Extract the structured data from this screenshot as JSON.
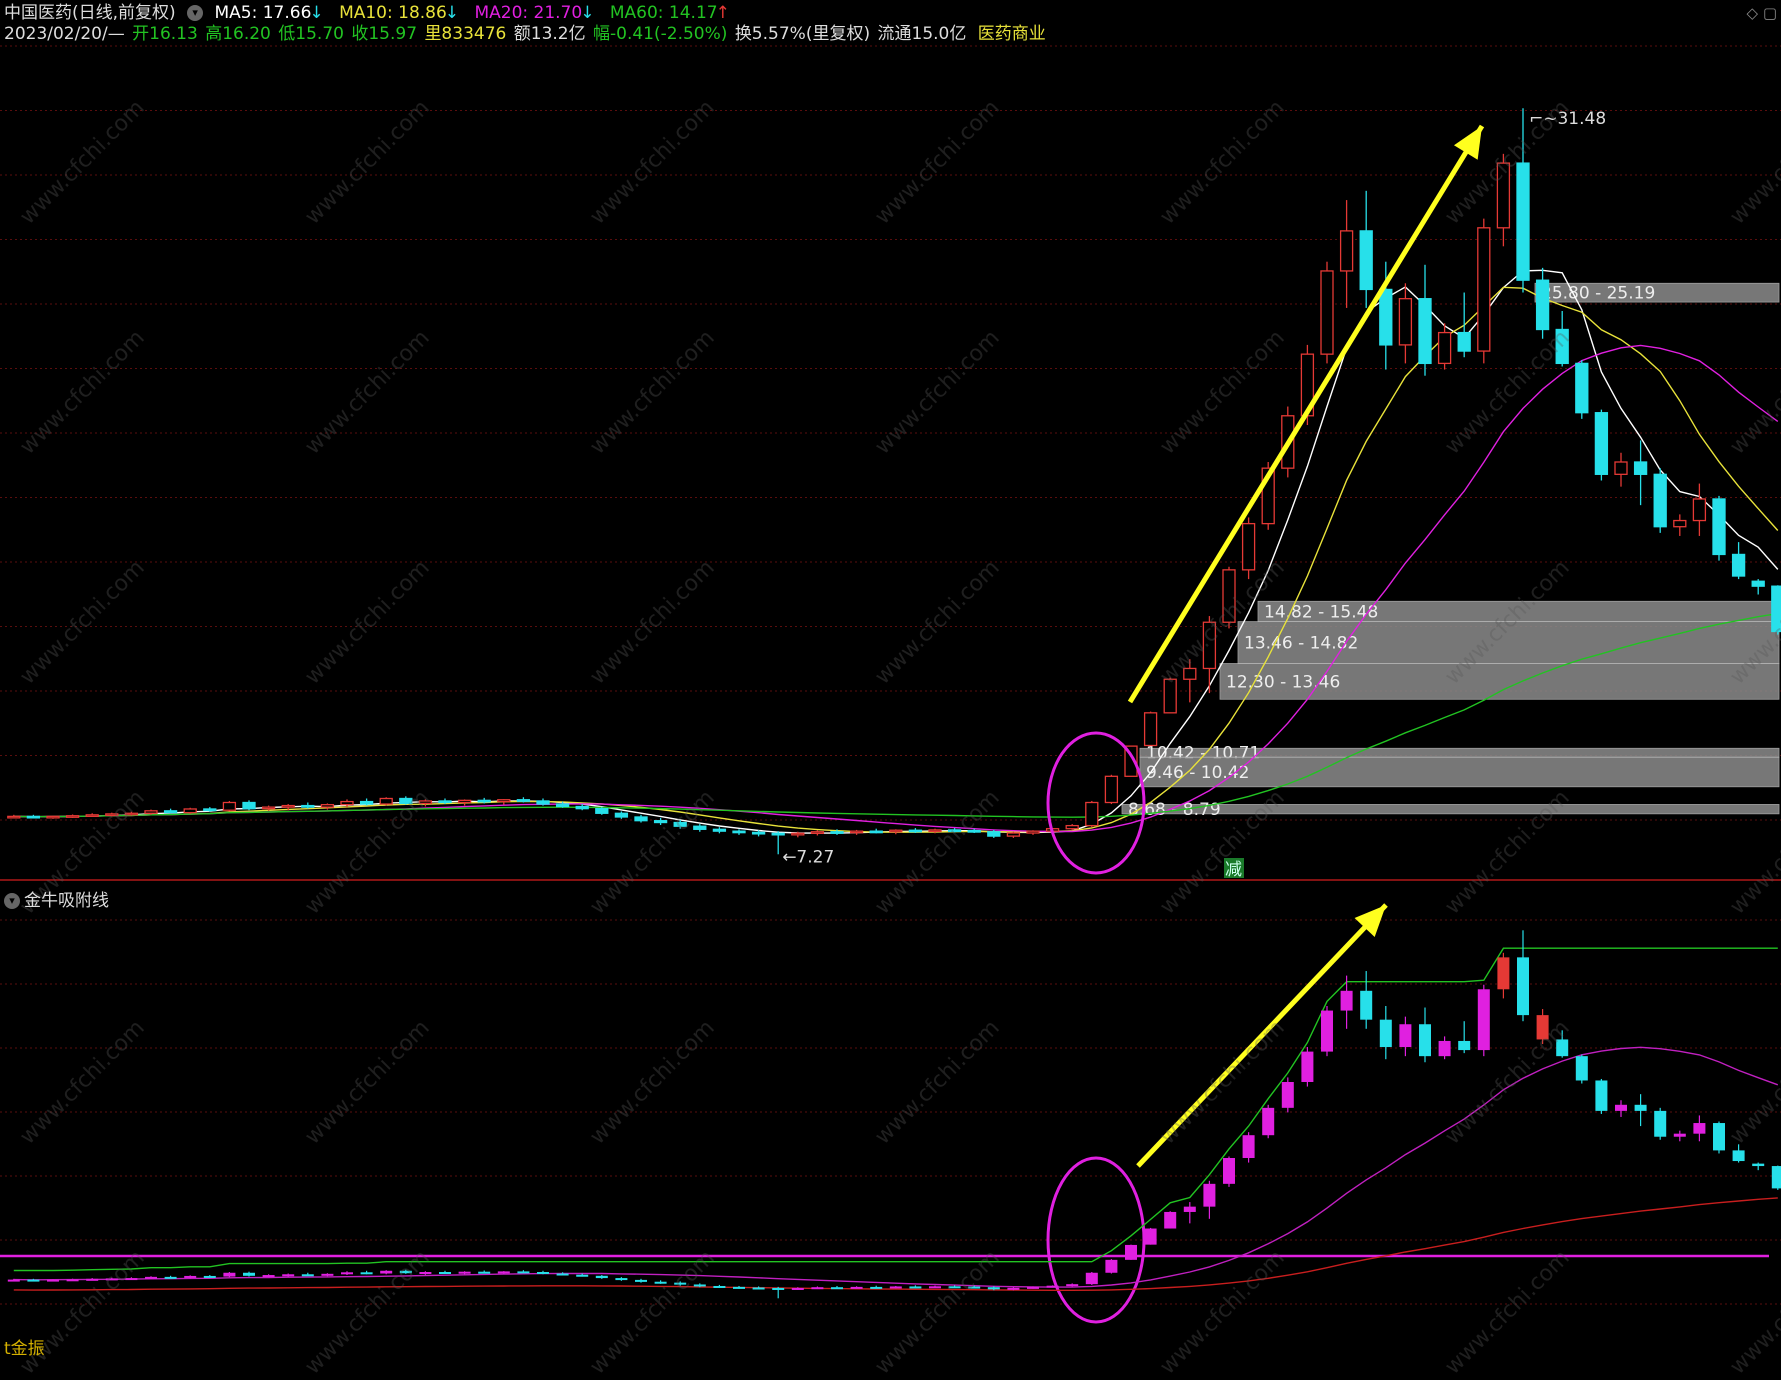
{
  "header": {
    "stock_name": "中国医药(日线,前复权)",
    "ma5": "MA5: 17.66",
    "ma10": "MA10: 18.86",
    "ma20": "MA20: 21.70",
    "ma60": "MA60: 14.17",
    "date": "2023/02/20/—",
    "open": "开16.13",
    "high": "高16.20",
    "low": "低15.70",
    "close": "收15.97",
    "volume": "里833476",
    "amount": "额13.2亿",
    "change": "幅-0.41(-2.50%)",
    "turnover": "换5.57%(里复权)",
    "float_cap": "流通15.0亿",
    "industry": "医药商业",
    "window_controls": "◇ ▢"
  },
  "colors": {
    "up": "#e53935",
    "down": "#27e0ea",
    "ma5": "#ffffff",
    "ma10": "#e8e23a",
    "ma20": "#e020e0",
    "ma60": "#22c322",
    "arrow": "#ffff1e",
    "circle": "#e020e0",
    "zone": "#8c8c8c"
  },
  "chart_data": [
    {
      "type": "candlestick",
      "title": "中国医药(日线,前复权)",
      "peak_label": "31.48",
      "trough_label": "7.27",
      "reduce_marker": "减",
      "price_zones": [
        {
          "label": "25.80 - 25.19",
          "low": 25.19,
          "high": 25.8
        },
        {
          "label": "14.82 - 15.48",
          "low": 14.82,
          "high": 15.48
        },
        {
          "label": "13.46 - 14.82",
          "low": 13.46,
          "high": 14.82
        },
        {
          "label": "12.30 - 13.46",
          "low": 12.3,
          "high": 13.46
        },
        {
          "label": "10.42 - 10.71",
          "low": 10.42,
          "high": 10.71
        },
        {
          "label": "9.46 - 10.42",
          "low": 9.46,
          "high": 10.42
        },
        {
          "label": "8.68 - 8.79",
          "low": 8.68,
          "high": 8.79
        }
      ],
      "candles": [
        [
          8.5,
          8.55,
          8.45,
          8.5
        ],
        [
          8.5,
          8.55,
          8.45,
          8.48
        ],
        [
          8.48,
          8.52,
          8.42,
          8.5
        ],
        [
          8.5,
          8.56,
          8.45,
          8.52
        ],
        [
          8.52,
          8.6,
          8.48,
          8.55
        ],
        [
          8.55,
          8.62,
          8.5,
          8.58
        ],
        [
          8.58,
          8.65,
          8.52,
          8.6
        ],
        [
          8.6,
          8.72,
          8.55,
          8.68
        ],
        [
          8.68,
          8.75,
          8.6,
          8.62
        ],
        [
          8.62,
          8.78,
          8.58,
          8.74
        ],
        [
          8.74,
          8.8,
          8.65,
          8.7
        ],
        [
          8.7,
          9.0,
          8.66,
          8.95
        ],
        [
          8.95,
          9.02,
          8.7,
          8.75
        ],
        [
          8.75,
          8.85,
          8.68,
          8.8
        ],
        [
          8.8,
          8.9,
          8.7,
          8.85
        ],
        [
          8.85,
          8.95,
          8.75,
          8.8
        ],
        [
          8.8,
          8.92,
          8.72,
          8.88
        ],
        [
          8.88,
          9.05,
          8.8,
          8.98
        ],
        [
          8.98,
          9.08,
          8.85,
          8.9
        ],
        [
          8.9,
          9.12,
          8.85,
          9.08
        ],
        [
          9.08,
          9.15,
          8.88,
          8.92
        ],
        [
          8.92,
          9.05,
          8.82,
          9.0
        ],
        [
          9.0,
          9.08,
          8.9,
          8.95
        ],
        [
          8.95,
          9.05,
          8.85,
          9.02
        ],
        [
          9.02,
          9.1,
          8.92,
          8.98
        ],
        [
          8.98,
          9.06,
          8.88,
          9.04
        ],
        [
          9.04,
          9.12,
          8.95,
          9.0
        ],
        [
          9.0,
          9.08,
          8.85,
          8.9
        ],
        [
          8.9,
          8.98,
          8.78,
          8.82
        ],
        [
          8.82,
          8.9,
          8.7,
          8.75
        ],
        [
          8.75,
          8.8,
          8.55,
          8.6
        ],
        [
          8.6,
          8.66,
          8.42,
          8.48
        ],
        [
          8.48,
          8.55,
          8.3,
          8.36
        ],
        [
          8.36,
          8.45,
          8.22,
          8.3
        ],
        [
          8.3,
          8.38,
          8.1,
          8.18
        ],
        [
          8.18,
          8.25,
          8.0,
          8.08
        ],
        [
          8.08,
          8.15,
          7.95,
          8.02
        ],
        [
          8.02,
          8.08,
          7.9,
          7.98
        ],
        [
          7.98,
          8.05,
          7.85,
          7.95
        ],
        [
          7.95,
          8.02,
          7.27,
          7.9
        ],
        [
          7.9,
          8.0,
          7.82,
          7.95
        ],
        [
          7.95,
          8.05,
          7.88,
          8.0
        ],
        [
          8.0,
          8.08,
          7.9,
          7.98
        ],
        [
          7.98,
          8.06,
          7.9,
          8.02
        ],
        [
          8.02,
          8.1,
          7.95,
          8.0
        ],
        [
          8.0,
          8.08,
          7.92,
          8.05
        ],
        [
          8.05,
          8.12,
          7.96,
          8.02
        ],
        [
          8.02,
          8.1,
          7.95,
          8.06
        ],
        [
          8.06,
          8.12,
          7.98,
          8.04
        ],
        [
          8.04,
          8.1,
          7.96,
          8.0
        ],
        [
          8.0,
          8.06,
          7.8,
          7.86
        ],
        [
          7.86,
          8.0,
          7.8,
          7.96
        ],
        [
          7.96,
          8.05,
          7.9,
          8.02
        ],
        [
          8.02,
          8.12,
          7.98,
          8.1
        ],
        [
          8.1,
          8.25,
          8.05,
          8.2
        ],
        [
          8.2,
          9.0,
          8.15,
          8.95
        ],
        [
          8.95,
          9.85,
          8.9,
          9.8
        ],
        [
          9.8,
          10.8,
          9.8,
          10.78
        ],
        [
          10.8,
          11.9,
          10.8,
          11.86
        ],
        [
          11.86,
          13.0,
          11.86,
          12.95
        ],
        [
          12.95,
          13.6,
          12.2,
          13.3
        ],
        [
          13.3,
          15.0,
          12.5,
          14.8
        ],
        [
          14.8,
          16.6,
          14.6,
          16.5
        ],
        [
          16.5,
          18.2,
          16.2,
          18.0
        ],
        [
          18.0,
          20.0,
          17.8,
          19.8
        ],
        [
          19.8,
          21.8,
          19.5,
          21.5
        ],
        [
          21.5,
          23.8,
          21.2,
          23.5
        ],
        [
          23.5,
          26.5,
          23.2,
          26.2
        ],
        [
          26.2,
          28.5,
          25.0,
          27.5
        ],
        [
          27.5,
          28.8,
          25.0,
          25.6
        ],
        [
          25.6,
          26.5,
          23.0,
          23.8
        ],
        [
          23.8,
          25.8,
          23.2,
          25.3
        ],
        [
          25.3,
          26.4,
          22.8,
          23.2
        ],
        [
          23.2,
          24.5,
          23.0,
          24.2
        ],
        [
          24.2,
          25.5,
          23.4,
          23.6
        ],
        [
          23.6,
          27.9,
          23.2,
          27.6
        ],
        [
          27.6,
          30.0,
          27.0,
          29.7
        ],
        [
          29.7,
          31.48,
          25.5,
          25.9
        ],
        [
          25.9,
          26.3,
          24.0,
          24.3
        ],
        [
          24.3,
          24.9,
          23.1,
          23.2
        ],
        [
          23.2,
          23.3,
          21.4,
          21.6
        ],
        [
          21.6,
          21.7,
          19.4,
          19.6
        ],
        [
          19.6,
          20.3,
          19.2,
          20.0
        ],
        [
          20.0,
          20.7,
          18.6,
          19.6
        ],
        [
          19.6,
          19.8,
          17.7,
          17.9
        ],
        [
          17.9,
          18.3,
          17.6,
          18.1
        ],
        [
          18.1,
          19.3,
          17.6,
          18.8
        ],
        [
          18.8,
          18.9,
          16.8,
          17.0
        ],
        [
          17.0,
          17.4,
          16.2,
          16.3
        ],
        [
          16.13,
          16.2,
          15.7,
          15.97
        ],
        [
          15.97,
          16.0,
          14.4,
          14.5
        ]
      ],
      "ma_series": [
        "MA5",
        "MA10",
        "MA20",
        "MA60"
      ],
      "ylim": [
        6.5,
        33.5
      ]
    },
    {
      "type": "indicator",
      "title": "金牛吸附线",
      "bottom_label": "t金振"
    }
  ],
  "watermark": "www.cfchi.com"
}
